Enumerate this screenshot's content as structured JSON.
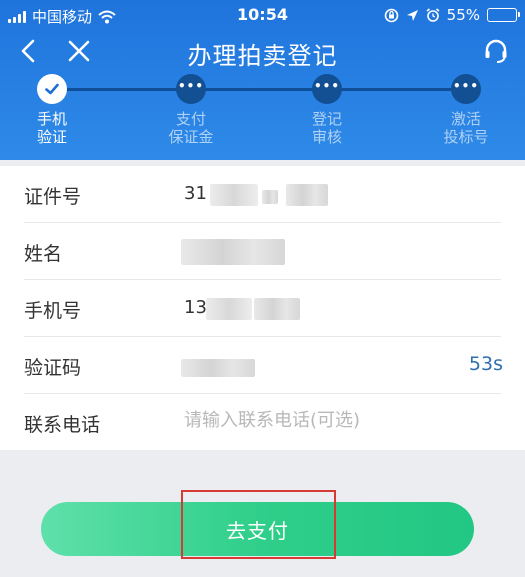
{
  "status_bar": {
    "carrier": "中国移动",
    "time": "10:54",
    "battery": "55%",
    "battery_level": 0.55
  },
  "nav": {
    "title": "办理拍卖登记"
  },
  "steps": [
    {
      "line1": "手机",
      "line2": "验证",
      "state": "done"
    },
    {
      "line1": "支付",
      "line2": "保证金",
      "state": "pending"
    },
    {
      "line1": "登记",
      "line2": "审核",
      "state": "pending"
    },
    {
      "line1": "激活",
      "line2": "投标号",
      "state": "pending"
    }
  ],
  "form": {
    "id_label": "证件号",
    "id_value_visible": "31",
    "name_label": "姓名",
    "phone_label": "手机号",
    "phone_value_visible": "13",
    "code_label": "验证码",
    "code_timer": "53s",
    "contact_label": "联系电话",
    "contact_placeholder": "请输入联系电话(可选)"
  },
  "actions": {
    "pay_label": "去支付"
  },
  "colors": {
    "header": "#2a80e4",
    "button": "#2fcf8a",
    "highlight": "#d63a32",
    "timer": "#2d6fb0"
  }
}
